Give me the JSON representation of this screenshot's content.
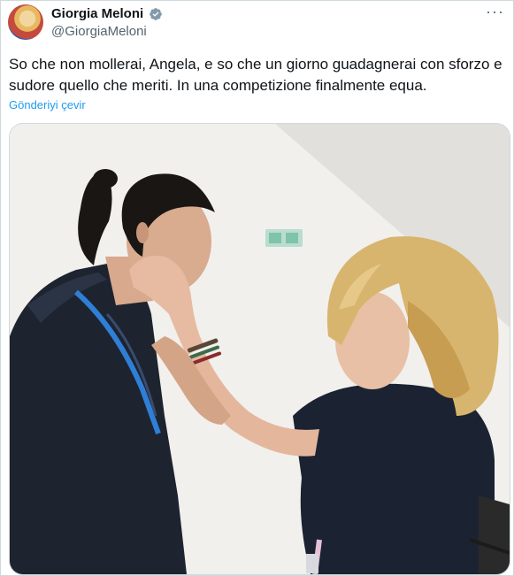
{
  "author": {
    "name": "Giorgia Meloni",
    "handle": "@GiorgiaMeloni",
    "verified_icon": "verified-badge-icon"
  },
  "tweet": {
    "text": "So che non mollerai, Angela, e so che un giorno guadagnerai con sforzo e sudore quello che meriti. In una competizione finalmente equa.",
    "translate_label": "Gönderiyi çevir"
  },
  "menu": {
    "more_label": "···"
  },
  "colors": {
    "link": "#1d9bf0",
    "secondary_text": "#536471",
    "border": "#cfd9de",
    "verified": "#829aab"
  }
}
